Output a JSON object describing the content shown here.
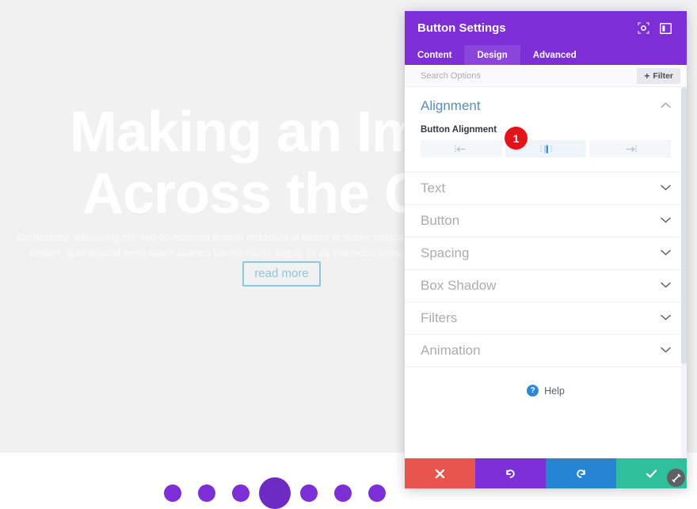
{
  "background_page": {
    "heading_line1": "Making an Imp",
    "heading_line2": "Across the Glo",
    "body_text": "Consectetur adipisicing elit, sed do eiusmod tempor incididunt ut labore et dolore magna aliqua. Ut enim ad minim veniam, quis nostrud exercitation ullamco laboris nisi ut aliquip ex ea commodo consequat. Duis aute irure d",
    "cta_label": "read more",
    "dot_count": 7,
    "active_dot_index": 3
  },
  "modal": {
    "title": "Button Settings",
    "header_icons": [
      {
        "name": "focus-target-icon",
        "label": "Focus"
      },
      {
        "name": "panel-layout-icon",
        "label": "Layout"
      }
    ],
    "tabs": [
      {
        "label": "Content",
        "active": false
      },
      {
        "label": "Design",
        "active": true
      },
      {
        "label": "Advanced",
        "active": false
      }
    ],
    "search": {
      "placeholder": "Search Options",
      "value": ""
    },
    "filter_button": {
      "label": "Filter",
      "plus": "+"
    },
    "alignment_section": {
      "title": "Alignment",
      "expanded": true,
      "chevron": "⌃",
      "field_label": "Button Alignment",
      "options": [
        {
          "name": "align-left",
          "selected": false
        },
        {
          "name": "align-center",
          "selected": true
        },
        {
          "name": "align-right",
          "selected": false
        }
      ]
    },
    "collapsed_sections": [
      {
        "title": "Text",
        "chevron": "⌄"
      },
      {
        "title": "Button",
        "chevron": "⌄"
      },
      {
        "title": "Spacing",
        "chevron": "⌄"
      },
      {
        "title": "Box Shadow",
        "chevron": "⌄"
      },
      {
        "title": "Filters",
        "chevron": "⌄"
      },
      {
        "title": "Animation",
        "chevron": "⌄"
      }
    ],
    "help": {
      "glyph": "?",
      "label": "Help"
    },
    "footer_buttons": [
      {
        "name": "cancel-button",
        "icon": "x-mark",
        "color": "#e8554e"
      },
      {
        "name": "undo-button",
        "icon": "undo-arrow",
        "color": "#7b2fd4"
      },
      {
        "name": "redo-button",
        "icon": "redo-arrow",
        "color": "#2584d4"
      },
      {
        "name": "save-button",
        "icon": "check-mark",
        "color": "#2fc09b"
      }
    ],
    "resize_handle": {
      "name": "resize-handle"
    }
  },
  "annotation_badge": {
    "number": "1"
  },
  "colors": {
    "brand_purple": "#7b2fd4",
    "tab_active": "#8a45db",
    "section_title": "#5b8fb5",
    "collapsed_title": "#a8adb3",
    "badge_red": "#e1141a",
    "help_blue": "#2b87da",
    "cta_border": "#8ec7dd"
  }
}
